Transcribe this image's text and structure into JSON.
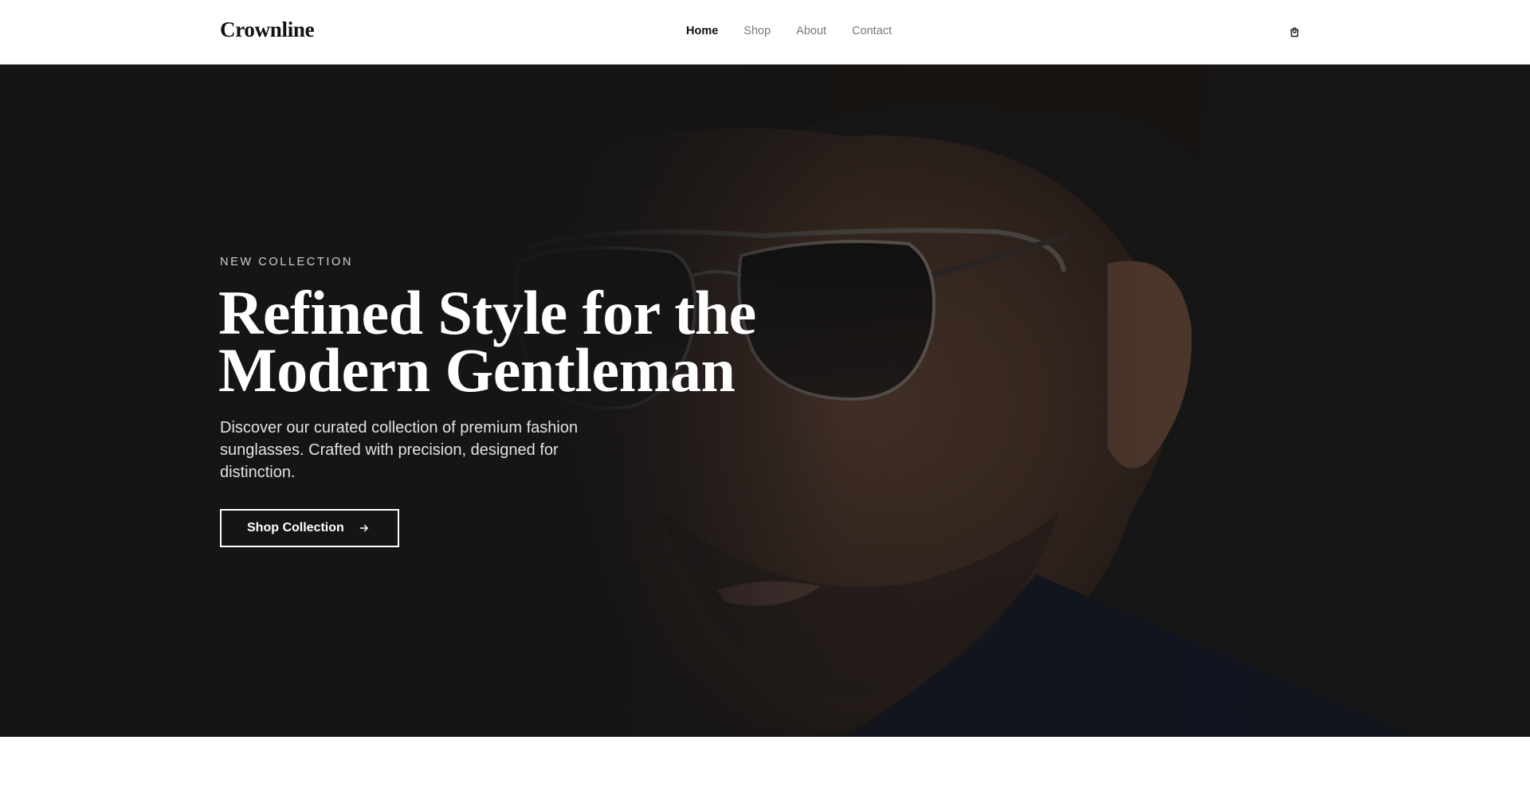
{
  "header": {
    "brand": "Crownline",
    "nav": [
      {
        "label": "Home",
        "active": true
      },
      {
        "label": "Shop",
        "active": false
      },
      {
        "label": "About",
        "active": false
      },
      {
        "label": "Contact",
        "active": false
      }
    ],
    "cart_icon": "shopping-bag-icon"
  },
  "hero": {
    "eyebrow": "NEW COLLECTION",
    "headline_line1": "Refined Style for the",
    "headline_line2": "Modern Gentleman",
    "subtitle": "Discover our curated collection of premium fashion sunglasses. Crafted with precision, designed for distinction.",
    "cta_label": "Shop Collection",
    "cta_icon": "arrow-right-icon"
  },
  "colors": {
    "hero_overlay": "#1a1a1b",
    "text_light": "#ffffff",
    "nav_inactive": "#7a7a7a"
  }
}
